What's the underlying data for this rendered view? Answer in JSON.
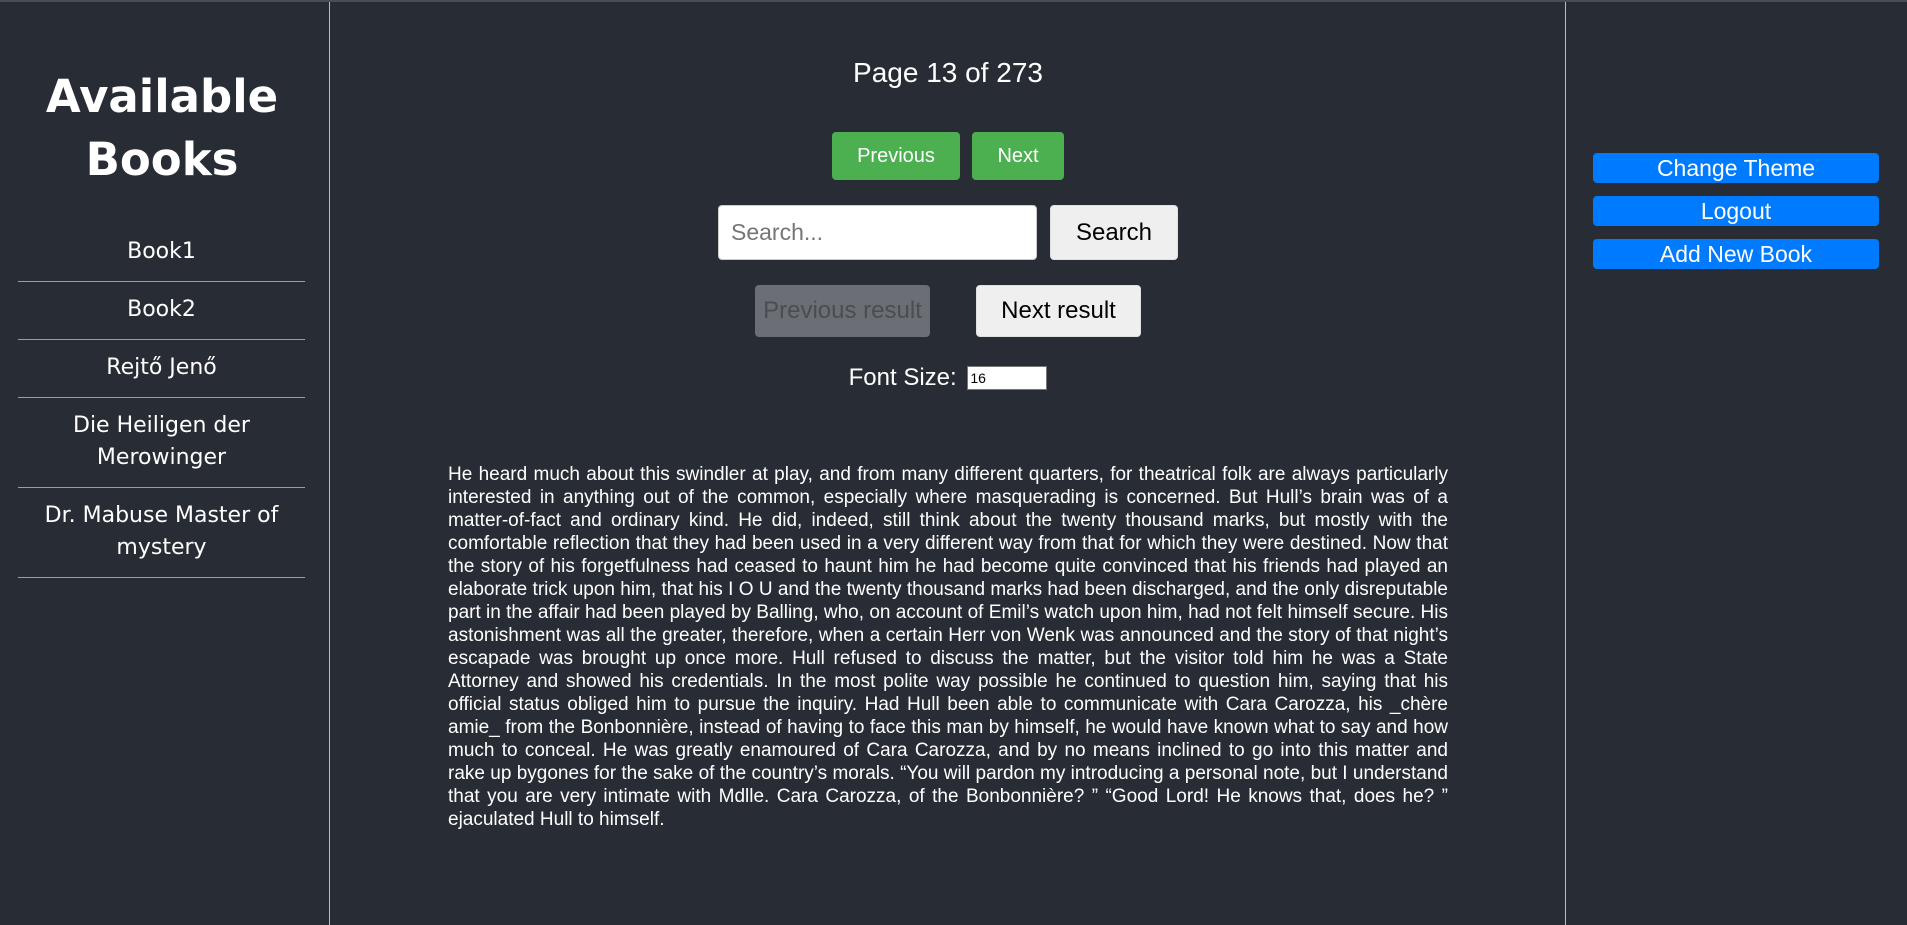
{
  "sidebar": {
    "title": "Available Books",
    "books": [
      {
        "label": "Book1"
      },
      {
        "label": "Book2"
      },
      {
        "label": "Rejtő Jenő"
      },
      {
        "label": "Die Heiligen der Merowinger"
      },
      {
        "label": "Dr. Mabuse Master of mystery"
      }
    ]
  },
  "reader": {
    "page_indicator": "Page 13 of 273",
    "previous_label": "Previous",
    "next_label": "Next",
    "search_placeholder": "Search...",
    "search_value": "",
    "search_label": "Search",
    "previous_result_label": "Previous result",
    "next_result_label": "Next result",
    "font_size_label": "Font Size:",
    "font_size_value": "16",
    "text": "He heard much about this swindler at play, and from many different quarters, for theatrical folk are always particularly interested in anything out of the common, especially where masquerading is concerned. But Hull’s brain was of a matter-of-fact and ordinary kind. He did, indeed, still think about the twenty thousand marks, but mostly with the comfortable reflection that they had been used in a very different way from that for which they were destined. Now that the story of his forgetfulness had ceased to haunt him he had become quite convinced that his friends had played an elaborate trick upon him, that his I O U and the twenty thousand marks had been discharged, and the only disreputable part in the affair had been played by Balling, who, on account of Emil’s watch upon him, had not felt himself secure. His astonishment was all the greater, therefore, when a certain Herr von Wenk was announced and the story of that night’s escapade was brought up once more. Hull refused to discuss the matter, but the visitor told him he was a State Attorney and showed his credentials. In the most polite way possible he continued to question him, saying that his official status obliged him to pursue the inquiry. Had Hull been able to communicate with Cara Carozza, his _chère amie_ from the Bonbonnière, instead of having to face this man by himself, he would have known what to say and how much to conceal. He was greatly enamoured of Cara Carozza, and by no means inclined to go into this matter and rake up bygones for the sake of the country’s morals. “You will pardon my introducing a personal note, but I understand that you are very intimate with Mdlle. Cara Carozza, of the Bonbonnière? ” “Good Lord! He knows that, does he? ” ejaculated Hull to himself."
  },
  "actions": {
    "change_theme_label": "Change Theme",
    "logout_label": "Logout",
    "add_book_label": "Add New Book"
  },
  "colors": {
    "background": "#282c34",
    "green_button": "#4caf50",
    "blue_button": "#007bff"
  }
}
